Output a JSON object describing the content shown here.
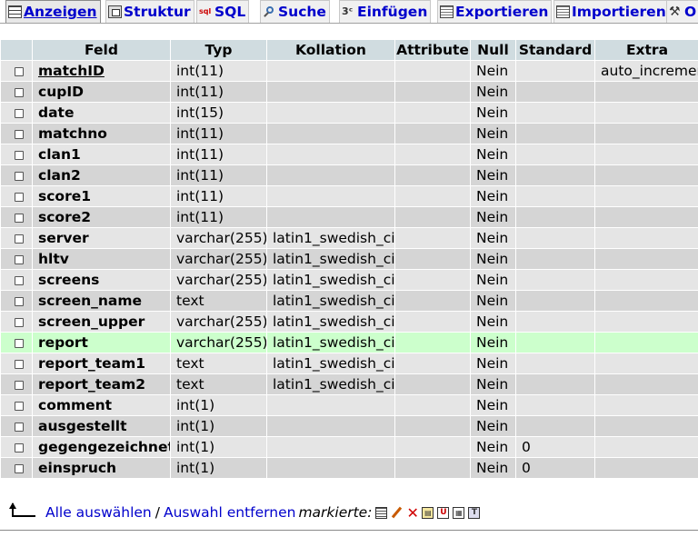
{
  "tabs": [
    {
      "label": "Anzeigen",
      "icon": "table-icon",
      "active": true
    },
    {
      "label": "Struktur",
      "icon": "structure-icon",
      "active": false
    },
    {
      "label": "SQL",
      "icon": "sql-icon",
      "active": false
    },
    {
      "label": "Suche",
      "icon": "search-icon",
      "active": false
    },
    {
      "label": "Einfügen",
      "icon": "insert-icon",
      "active": false
    },
    {
      "label": "Exportieren",
      "icon": "export-icon",
      "active": false
    },
    {
      "label": "Importieren",
      "icon": "import-icon",
      "active": false
    },
    {
      "label": "O",
      "icon": "tools-icon",
      "active": false
    }
  ],
  "table": {
    "headers": [
      "Feld",
      "Typ",
      "Kollation",
      "Attribute",
      "Null",
      "Standard",
      "Extra"
    ],
    "rows": [
      {
        "field": "matchID",
        "type": "int(11)",
        "collation": "",
        "attribute": "",
        "null": "Nein",
        "default": "",
        "extra": "auto_increment"
      },
      {
        "field": "cupID",
        "type": "int(11)",
        "collation": "",
        "attribute": "",
        "null": "Nein",
        "default": "",
        "extra": ""
      },
      {
        "field": "date",
        "type": "int(15)",
        "collation": "",
        "attribute": "",
        "null": "Nein",
        "default": "",
        "extra": ""
      },
      {
        "field": "matchno",
        "type": "int(11)",
        "collation": "",
        "attribute": "",
        "null": "Nein",
        "default": "",
        "extra": ""
      },
      {
        "field": "clan1",
        "type": "int(11)",
        "collation": "",
        "attribute": "",
        "null": "Nein",
        "default": "",
        "extra": ""
      },
      {
        "field": "clan2",
        "type": "int(11)",
        "collation": "",
        "attribute": "",
        "null": "Nein",
        "default": "",
        "extra": ""
      },
      {
        "field": "score1",
        "type": "int(11)",
        "collation": "",
        "attribute": "",
        "null": "Nein",
        "default": "",
        "extra": ""
      },
      {
        "field": "score2",
        "type": "int(11)",
        "collation": "",
        "attribute": "",
        "null": "Nein",
        "default": "",
        "extra": ""
      },
      {
        "field": "server",
        "type": "varchar(255)",
        "collation": "latin1_swedish_ci",
        "attribute": "",
        "null": "Nein",
        "default": "",
        "extra": ""
      },
      {
        "field": "hltv",
        "type": "varchar(255)",
        "collation": "latin1_swedish_ci",
        "attribute": "",
        "null": "Nein",
        "default": "",
        "extra": ""
      },
      {
        "field": "screens",
        "type": "varchar(255)",
        "collation": "latin1_swedish_ci",
        "attribute": "",
        "null": "Nein",
        "default": "",
        "extra": ""
      },
      {
        "field": "screen_name",
        "type": "text",
        "collation": "latin1_swedish_ci",
        "attribute": "",
        "null": "Nein",
        "default": "",
        "extra": ""
      },
      {
        "field": "screen_upper",
        "type": "varchar(255)",
        "collation": "latin1_swedish_ci",
        "attribute": "",
        "null": "Nein",
        "default": "",
        "extra": ""
      },
      {
        "field": "report",
        "type": "varchar(255)",
        "collation": "latin1_swedish_ci",
        "attribute": "",
        "null": "Nein",
        "default": "",
        "extra": ""
      },
      {
        "field": "report_team1",
        "type": "text",
        "collation": "latin1_swedish_ci",
        "attribute": "",
        "null": "Nein",
        "default": "",
        "extra": ""
      },
      {
        "field": "report_team2",
        "type": "text",
        "collation": "latin1_swedish_ci",
        "attribute": "",
        "null": "Nein",
        "default": "",
        "extra": ""
      },
      {
        "field": "comment",
        "type": "int(1)",
        "collation": "",
        "attribute": "",
        "null": "Nein",
        "default": "",
        "extra": ""
      },
      {
        "field": "ausgestellt",
        "type": "int(1)",
        "collation": "",
        "attribute": "",
        "null": "Nein",
        "default": "",
        "extra": ""
      },
      {
        "field": "gegengezeichnet",
        "type": "int(1)",
        "collation": "",
        "attribute": "",
        "null": "Nein",
        "default": "0",
        "extra": ""
      },
      {
        "field": "einspruch",
        "type": "int(1)",
        "collation": "",
        "attribute": "",
        "null": "Nein",
        "default": "0",
        "extra": ""
      }
    ],
    "highlighted_row": "report",
    "primary_key": "matchID"
  },
  "footer": {
    "select_all": "Alle auswählen",
    "separator": "/",
    "deselect_all": "Auswahl entfernen",
    "with_selected": "markierte:",
    "actions": [
      {
        "icon": "browse-icon",
        "glyph": ""
      },
      {
        "icon": "edit-icon",
        "glyph": ""
      },
      {
        "icon": "delete-icon",
        "glyph": "✕"
      },
      {
        "icon": "primary-key-icon",
        "glyph": "▤"
      },
      {
        "icon": "unique-icon",
        "glyph": "U"
      },
      {
        "icon": "index-icon",
        "glyph": "▦"
      },
      {
        "icon": "fulltext-icon",
        "glyph": "T"
      }
    ]
  },
  "colors": {
    "header_bg": "#d0dce0",
    "row_odd": "#e5e5e5",
    "row_even": "#d5d5d5",
    "row_highlight": "#ccffcc",
    "link": "#0000cc"
  }
}
